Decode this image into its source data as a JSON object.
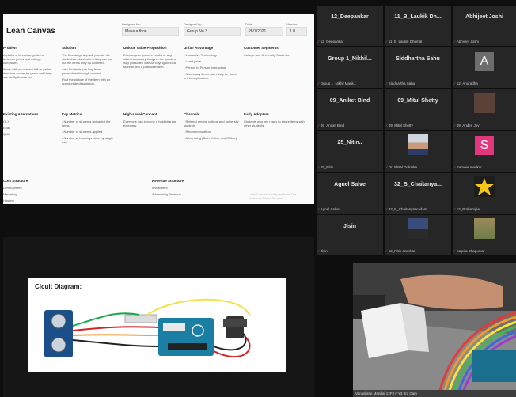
{
  "lean_canvas": {
    "title": "Lean Canvas",
    "header": [
      {
        "label": "Designed for:",
        "value": "Make a thon"
      },
      {
        "label": "Designed by:",
        "value": "Group No.3"
      },
      {
        "label": "Date:",
        "value": "28/7/2021"
      },
      {
        "label": "Version:",
        "value": "1.0"
      }
    ],
    "problem": {
      "heading": "Problem",
      "lines": [
        "A platform to exchange items between peers and college campuses.",
        "Items with no use are left to gather dust in a corner for years until they are finally thrown out."
      ]
    },
    "solution": {
      "heading": "Solution",
      "lines": [
        "The Exchange app will provide the students a place where they can put out the items they do not need.",
        "Also Students can buy from peers/other through contact.",
        "Post the picture of the item with an appropriate description."
      ]
    },
    "uvp": {
      "heading": "Unique Value Proposition",
      "lines": [
        "Exchange or procure books or any other necessary things in the quickest way possible / without relying on local store to find a particular item."
      ]
    },
    "unfair": {
      "heading": "Unfair Advantage",
      "lines": [
        "- Innovative Technology",
        "- Least price",
        "- Person to Person Interaction",
        "- Necessary items can easily be found in this application."
      ]
    },
    "segments": {
      "heading": "Customer Segments",
      "lines": [
        "College and University Students."
      ]
    },
    "existing": {
      "heading": "Existing Alternatives",
      "lines": [
        "OLX",
        "Ebay",
        "Quikr"
      ]
    },
    "metrics": {
      "heading": "Key Metrics",
      "lines": [
        "- Number of students uploaded the items",
        "- Number of students applied",
        "- Number of bookings done by single user"
      ]
    },
    "hlc": {
      "heading": "High-Level Concept",
      "lines": [
        "Everyone can become a host sharing economy."
      ]
    },
    "channels": {
      "heading": "Channels",
      "lines": [
        "- Referral among college and university students",
        "- Recommendation",
        "- Advertising (Both Online and Offline)"
      ]
    },
    "adopters": {
      "heading": "Early Adopters",
      "lines": [
        "Students who are ready to share items with other students."
      ]
    },
    "cost": {
      "heading": "Cost Structure",
      "lines": [
        "Development",
        "Marketing",
        "Hosting"
      ]
    },
    "revenue": {
      "heading": "Revenue Structure",
      "lines": [
        "Investment",
        "Advertising Revenue"
      ]
    },
    "watermark": "Lean Canvas is adapted from The Business Model Canvas"
  },
  "slide": {
    "title": "Cicuit Diagram:"
  },
  "participants": [
    {
      "name": "12_Deepankar",
      "sub": "12_Deepankar",
      "type": "name"
    },
    {
      "name": "11_B_Laukik Dh...",
      "sub": "11_B_Laukik Dhumal",
      "type": "name"
    },
    {
      "name": "Abhijeet Joshi",
      "sub": "Abhijeet Joshi",
      "type": "name"
    },
    {
      "name": "Group 1_Nikhil...",
      "sub": "Group 1_Nikhil Mank...",
      "type": "name"
    },
    {
      "name": "Siddhartha Sahu",
      "sub": "Siddhartha Sahu",
      "type": "name"
    },
    {
      "name": "A",
      "sub": "12_Anuradha",
      "type": "letter",
      "color": "#6d6d6d"
    },
    {
      "name": "09_Aniket Bind",
      "sub": "09_Aniket Bind",
      "type": "name"
    },
    {
      "name": "09_Mitul Shetty",
      "sub": "09_Mitul Shetty",
      "type": "name"
    },
    {
      "name": "",
      "sub": "09_Anden Joy",
      "type": "photo-dark"
    },
    {
      "name": "25_Nitin..",
      "sub": "25_Nitin..",
      "type": "name"
    },
    {
      "name": "",
      "sub": "Dr. Shital Dokarka",
      "type": "photo-person"
    },
    {
      "name": "S",
      "sub": "Sameer medkar",
      "type": "letter",
      "color": "#e2377d"
    },
    {
      "name": "Agnel Salve",
      "sub": "Agnel Salve",
      "type": "name"
    },
    {
      "name": "32_B_Chaitanya...",
      "sub": "32_B_Chaitanya Kadam",
      "type": "name"
    },
    {
      "name": "",
      "sub": "12_Brahamjeet",
      "type": "photo-star"
    },
    {
      "name": "Jisin",
      "sub": "Jisin",
      "type": "name"
    },
    {
      "name": "",
      "sub": "12_Nitin anavkar",
      "type": "photo-car"
    },
    {
      "name": "",
      "sub": "Kalpita Bhagurkar",
      "type": "photo-animal"
    }
  ],
  "camera": {
    "caption": "Vanashree Mandal 12F3 # Y3 3rd Cam"
  }
}
